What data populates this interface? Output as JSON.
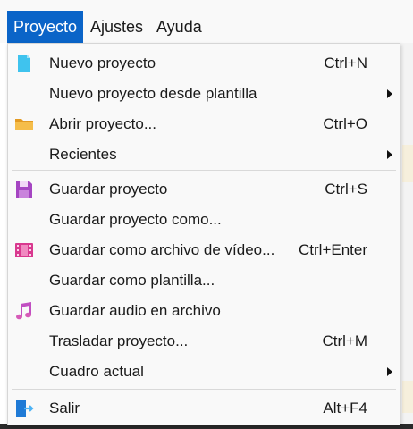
{
  "menubar": {
    "items": [
      {
        "label": "Proyecto"
      },
      {
        "label": "Ajustes"
      },
      {
        "label": "Ayuda"
      }
    ]
  },
  "menu": {
    "items": [
      {
        "label": "Nuevo proyecto",
        "shortcut": "Ctrl+N",
        "icon": "new-file-icon"
      },
      {
        "label": "Nuevo proyecto desde plantilla",
        "shortcut": "",
        "submenu": true
      },
      {
        "label": "Abrir proyecto...",
        "shortcut": "Ctrl+O",
        "icon": "folder-icon"
      },
      {
        "label": "Recientes",
        "shortcut": "",
        "submenu": true
      },
      {
        "label": "Guardar proyecto",
        "shortcut": "Ctrl+S",
        "icon": "save-icon"
      },
      {
        "label": "Guardar proyecto como...",
        "shortcut": ""
      },
      {
        "label": "Guardar como archivo de vídeo...",
        "shortcut": "Ctrl+Enter",
        "icon": "film-icon"
      },
      {
        "label": "Guardar como plantilla...",
        "shortcut": ""
      },
      {
        "label": "Guardar audio en archivo",
        "shortcut": "",
        "icon": "music-icon"
      },
      {
        "label": "Trasladar proyecto...",
        "shortcut": "Ctrl+M"
      },
      {
        "label": "Cuadro actual",
        "shortcut": "",
        "submenu": true
      },
      {
        "label": "Salir",
        "shortcut": "Alt+F4",
        "icon": "exit-icon"
      }
    ]
  },
  "colors": {
    "accent": "#0a64c8",
    "menu_bg": "#f9f9f9",
    "new_icon": "#3fc3ee",
    "folder_icon": "#f2b33d",
    "save_icon": "#b04fc7",
    "film_icon": "#e0469e",
    "music_icon": "#c54fc3",
    "exit_icon": "#2a86e0"
  }
}
